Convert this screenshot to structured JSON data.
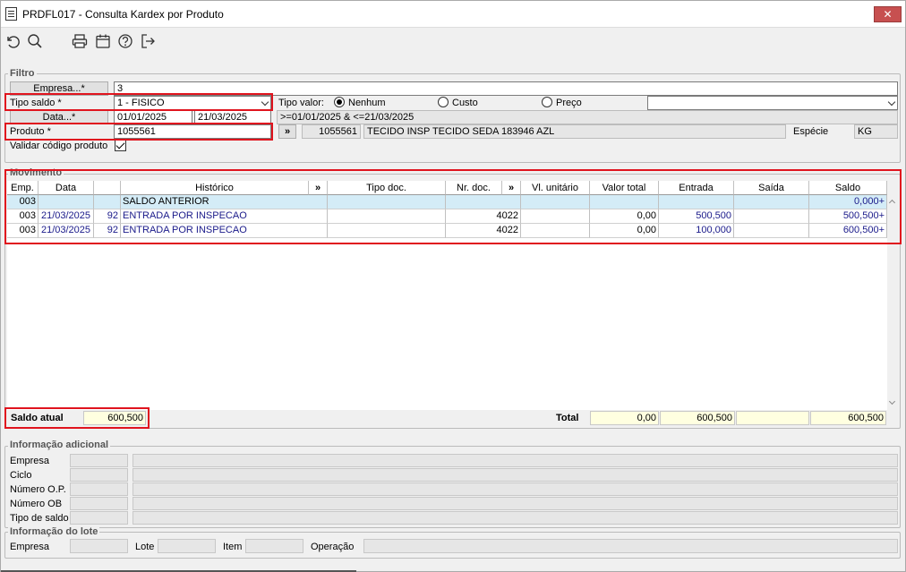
{
  "window": {
    "title": "PRDFL017 - Consulta Kardex por Produto",
    "close_glyph": "✕"
  },
  "toolbar": {
    "icons": [
      "undo-icon",
      "search-icon",
      "print-icon",
      "calendar-icon",
      "help-icon",
      "exit-icon"
    ]
  },
  "filtro": {
    "label": "Filtro",
    "empresa_label": "Empresa...*",
    "empresa_value": "3",
    "tipo_saldo_label": "Tipo saldo *",
    "tipo_saldo_value": "1 - FISICO",
    "tipo_valor_label": "Tipo valor:",
    "tipo_valor_options": [
      "Nenhum",
      "Custo",
      "Preço"
    ],
    "tipo_valor_selected": "Nenhum",
    "data_label": "Data...*",
    "data_from": "01/01/2025",
    "data_to": "21/03/2025",
    "data_expression": ">=01/01/2025 & <=21/03/2025",
    "produto_label": "Produto *",
    "produto_value": "1055561",
    "produto_button": "»",
    "produto_code": "1055561",
    "produto_desc": "TECIDO INSP TECIDO SEDA 183946 AZL",
    "especie_label": "Espécie",
    "especie_value": "KG",
    "validar_label": "Validar código produto",
    "validar_checked": true
  },
  "movimento": {
    "label": "Movimento",
    "columns": [
      "Emp.",
      "Data",
      "",
      "Histórico",
      "»",
      "Tipo doc.",
      "Nr. doc.",
      "»",
      "Vl. unitário",
      "Valor total",
      "Entrada",
      "Saída",
      "Saldo"
    ],
    "rows": [
      {
        "emp": "003",
        "data": "",
        "nr": "",
        "historico": "SALDO ANTERIOR",
        "tipo_doc": "",
        "nr_doc": "",
        "vl_unit": "",
        "valor_total": "",
        "entrada": "",
        "saida": "",
        "saldo": "0,000+"
      },
      {
        "emp": "003",
        "data": "21/03/2025",
        "nr": "92",
        "historico": "ENTRADA POR INSPECAO",
        "tipo_doc": "",
        "nr_doc": "4022",
        "vl_unit": "",
        "valor_total": "0,00",
        "entrada": "500,500",
        "saida": "",
        "saldo": "500,500+"
      },
      {
        "emp": "003",
        "data": "21/03/2025",
        "nr": "92",
        "historico": "ENTRADA POR INSPECAO",
        "tipo_doc": "",
        "nr_doc": "4022",
        "vl_unit": "",
        "valor_total": "0,00",
        "entrada": "100,000",
        "saida": "",
        "saldo": "600,500+"
      }
    ]
  },
  "totais": {
    "saldo_atual_label": "Saldo atual",
    "saldo_atual_value": "600,500",
    "total_label": "Total",
    "valor_total": "0,00",
    "entrada": "600,500",
    "saida": "",
    "saldo": "600,500"
  },
  "info_adicional": {
    "label": "Informação adicional",
    "fields": [
      "Empresa",
      "Ciclo",
      "Número O.P.",
      "Número OB",
      "Tipo de saldo"
    ]
  },
  "info_lote": {
    "label": "Informação do lote",
    "empresa_label": "Empresa",
    "lote_label": "Lote",
    "item_label": "Item",
    "operacao_label": "Operação"
  }
}
